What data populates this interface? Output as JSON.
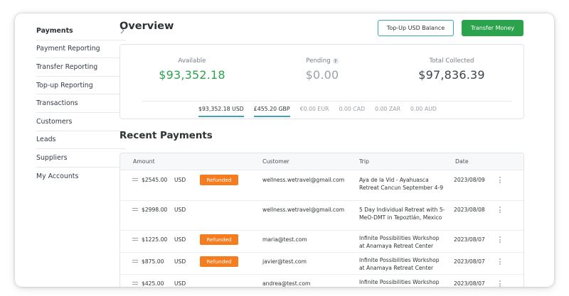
{
  "sidebar": {
    "items": [
      {
        "label": "Payments",
        "active": true
      },
      {
        "label": "Payment Reporting"
      },
      {
        "label": "Transfer Reporting"
      },
      {
        "label": "Top-up Reporting"
      },
      {
        "label": "Transactions"
      },
      {
        "label": "Customers"
      },
      {
        "label": "Leads"
      },
      {
        "label": "Suppliers"
      },
      {
        "label": "My Accounts"
      }
    ]
  },
  "header": {
    "title": "Overview",
    "topup_label": "Top-Up USD Balance",
    "transfer_label": "Transfer Money"
  },
  "balances": {
    "available_label": "Available",
    "available_value": "$93,352.18",
    "pending_label": "Pending",
    "pending_help": "?",
    "pending_value": "$0.00",
    "total_label": "Total Collected",
    "total_value": "$97,836.39",
    "currencies": [
      {
        "label": "$93,352.18 USD",
        "selected": true
      },
      {
        "label": "£455.20 GBP",
        "selected": true
      },
      {
        "label": "€0.00 EUR"
      },
      {
        "label": "0.00 CAD"
      },
      {
        "label": "0.00 ZAR"
      },
      {
        "label": "0.00 AUD"
      }
    ]
  },
  "recent": {
    "title": "Recent Payments",
    "columns": {
      "amount": "Amount",
      "customer": "Customer",
      "trip": "Trip",
      "date": "Date"
    },
    "rows": [
      {
        "amount": "$2545.00",
        "currency": "USD",
        "status": "Refunded",
        "customer": "wellness.wetravel@gmail.com",
        "trip": "Aya de la Vid - Ayahuasca Retreat Cancun September 4-9",
        "date": "2023/08/09"
      },
      {
        "amount": "$2998.00",
        "currency": "USD",
        "status": "",
        "customer": "wellness.wetravel@gmail.com",
        "trip": "5 Day Individual Retreat with 5-MeO-DMT in Tepoztlán, Mexico",
        "date": "2023/08/08"
      },
      {
        "amount": "$1225.00",
        "currency": "USD",
        "status": "Refunded",
        "customer": "maria@test.com",
        "trip": "Infinite Possibilities Workshop at Anamaya Retreat Center",
        "date": "2023/08/07"
      },
      {
        "amount": "$875.00",
        "currency": "USD",
        "status": "Refunded",
        "customer": "javier@test.com",
        "trip": "Infinite Possibilities Workshop at Anamaya Retreat Center",
        "date": "2023/08/07"
      },
      {
        "amount": "$425.00",
        "currency": "USD",
        "status": "",
        "customer": "andrea@test.com",
        "trip": "Infinite Possibilities Workshop",
        "date": "2023/08/07"
      }
    ]
  },
  "colors": {
    "accent_green": "#2ba24c",
    "accent_teal": "#3fa3b8",
    "refunded_orange": "#f57c1f"
  }
}
